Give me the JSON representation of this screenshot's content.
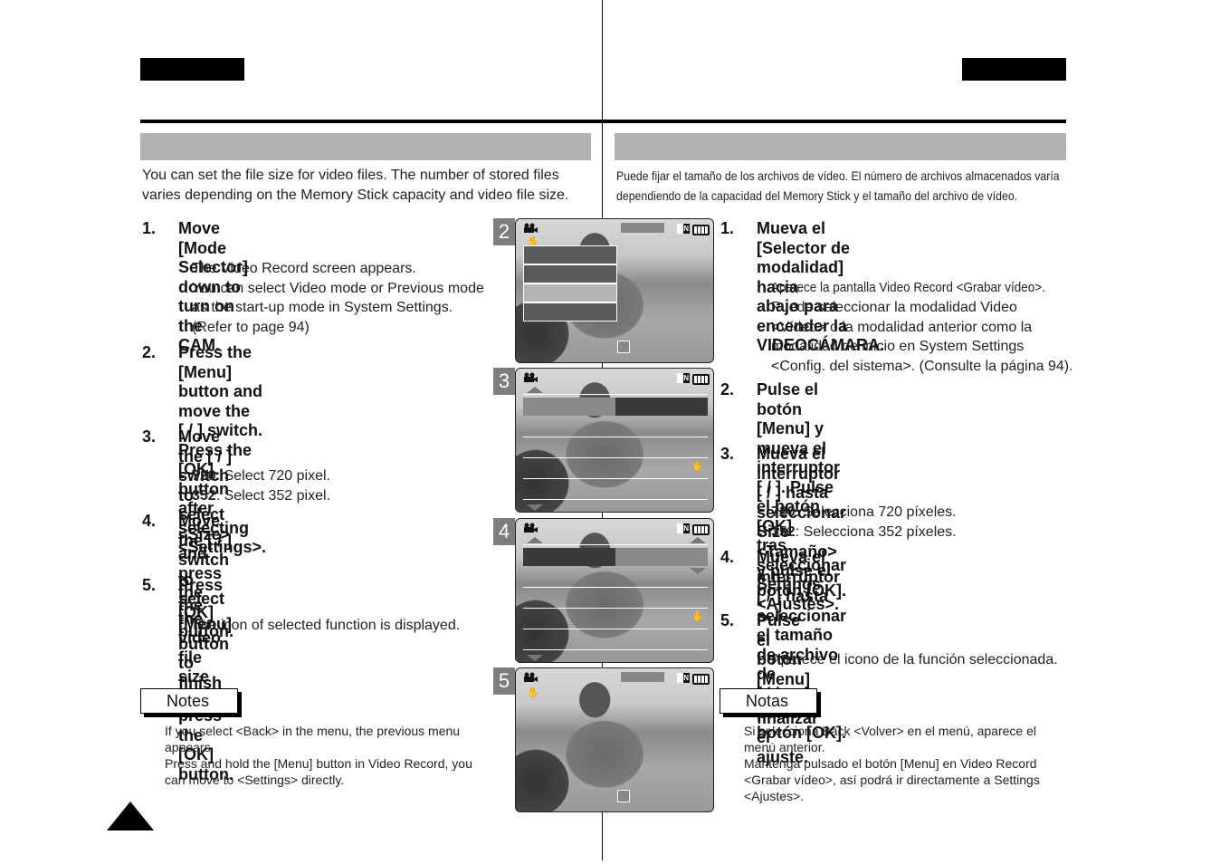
{
  "english": {
    "intro": "You can set the file size for video files. The number of stored files\nvaries depending on the Memory Stick capacity and video file size.",
    "steps": [
      {
        "num": "1.",
        "text": "Move [Mode Selector] down to turn on\nthe CAM."
      },
      {
        "num": "2.",
        "text": "Press the [Menu] button and move the\n[    /    ] switch.\nPress the [OK] button after selecting\n<Settings>."
      },
      {
        "num": "3.",
        "text": "Move the [    /    ] switch to select\n<Size> and press the [OK] button."
      },
      {
        "num": "4.",
        "text": "Move the [    /    ] switch to select the\nvideo file size and\npress the [OK] button."
      },
      {
        "num": "5.",
        "text": "Press the [Menu] button to finish\nsetting."
      }
    ],
    "step1_sub": "The Video Record screen appears.\nYou can select Video mode or Previous mode\n as the start-up mode in System Settings.\n (Refer to page 94)",
    "step3_sub": [
      {
        "key": "720",
        "desc": ": Select 720 pixel."
      },
      {
        "key": "352",
        "desc": ": Select 352 pixel."
      }
    ],
    "step5_sub": "The icon of selected function is displayed.",
    "notes_label": "Notes",
    "notes_text": "If you select <Back> in the menu, the previous menu\nappears.\nPress and hold the [Menu] button in Video Record, you\ncan move to <Settings> directly."
  },
  "spanish": {
    "intro": "Puede fijar el tamaño de los archivos de vídeo. El número de archivos almacenados varía\ndependiendo de la capacidad del Memory Stick y el tamaño del archivo de vídeo.",
    "steps": [
      {
        "num": "1.",
        "text": "Mueva el [Selector de modalidad] hacia\nabajo para encender la\nVIDEOCÁMARA."
      },
      {
        "num": "2.",
        "text": "Pulse el botón [Menu] y mueva el\ninterruptor [    /    ]. Pulse el botón [OK]\ntras seleccionar Settings <Ajustes>."
      },
      {
        "num": "3.",
        "text": "Mueva el interruptor [    /    ] hasta\nseleccionar Size <Tamaño> y pulse el\nbotón [OK]."
      },
      {
        "num": "4.",
        "text": "Mueva el interruptor [    /    ] hasta\nseleccionar el tamaño de archivo de\nvídeo y pulse el botón [OK]."
      },
      {
        "num": "5.",
        "text": "Pulse el botón [Menu] para finalizar el\najuste."
      }
    ],
    "step1_sub_a": "Aparece la pantalla Video Record <Grabar vídeo>.",
    "step1_sub_b": "Puede seleccionar la modalidad Video\n <Vídeo> o la modalidad anterior como la\n modalidad de inicio en System Settings\n <Config. del sistema>. (Consulte la página 94).",
    "step3_sub": [
      {
        "key": "720",
        "desc": ": Selecciona 720 píxeles."
      },
      {
        "key": "352",
        "desc": ": Selecciona 352 píxeles."
      }
    ],
    "step5_sub": "Aparece el icono de la función seleccionada.",
    "notes_label": "Notas",
    "notes_text": "Si selecciona Back <Volver> en el menú, aparece el\nmenú anterior.\nMantenga pulsado el botón [Menu] en Video Record\n<Grabar vídeo>, así podrá ir directamente a Settings\n<Ajustes>."
  },
  "screens": [
    {
      "label": "2",
      "mem_badge": "N"
    },
    {
      "label": "3",
      "mem_badge": "N"
    },
    {
      "label": "4",
      "mem_badge": "N"
    },
    {
      "label": "5",
      "mem_badge": "N"
    }
  ],
  "icons": {
    "camera": "video-camera-icon",
    "hand": "anti-shake-hand-icon",
    "memory": "memory-stick-icon",
    "battery": "battery-icon",
    "page_marker": "page-triangle-icon"
  }
}
